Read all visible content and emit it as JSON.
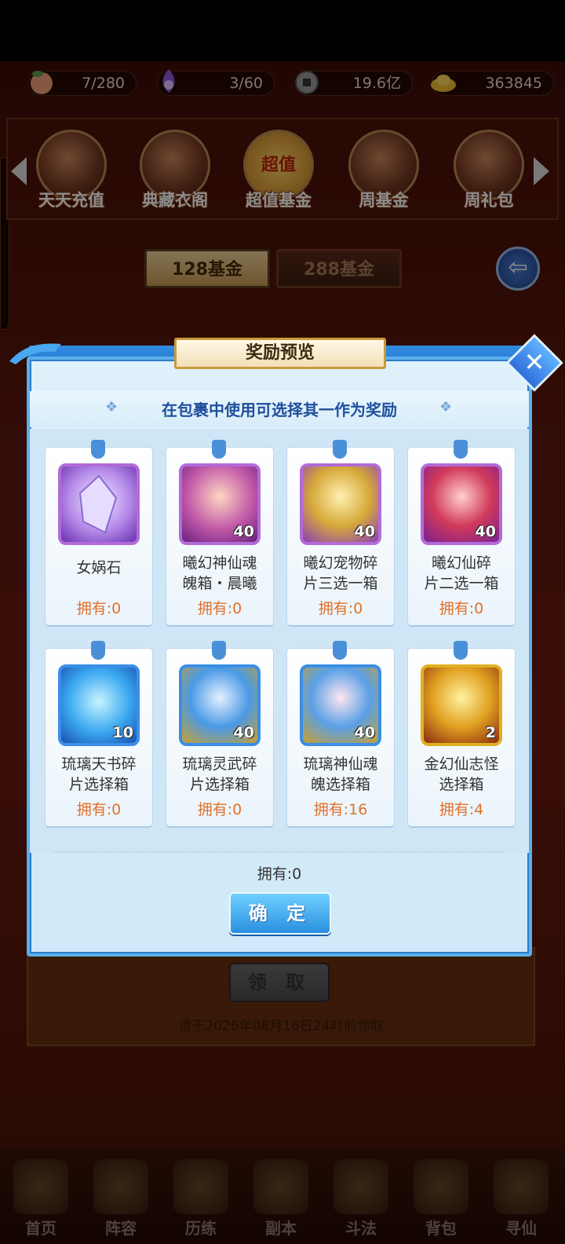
{
  "resources": [
    {
      "name": "peach-icon",
      "value": "7/280",
      "color": "#e88a6a"
    },
    {
      "name": "spirit-flame-icon",
      "value": "3/60",
      "color": "#8a5ae0"
    },
    {
      "name": "coin-icon",
      "value": "19.6亿",
      "color": "#777777"
    },
    {
      "name": "gold-ingot-icon",
      "value": "363845",
      "color": "#f0c030"
    }
  ],
  "tabs": [
    {
      "label": "天天充值",
      "icon": "red-envelope-icon"
    },
    {
      "label": "典藏衣阁",
      "icon": "treasure-chest-icon"
    },
    {
      "label": "超值基金",
      "icon": "super-value-icon",
      "badge": "超值"
    },
    {
      "label": "周基金",
      "icon": "gold-pile-icon"
    },
    {
      "label": "周礼包",
      "icon": "gift-box-icon"
    }
  ],
  "fund_tabs": {
    "active": "128基金",
    "inactive": "288基金"
  },
  "dialog": {
    "title": "奖励预览",
    "subtitle": "在包裹中使用可选择其一作为奖励",
    "items": [
      {
        "name": "女娲石",
        "own": "拥有:0",
        "qty": "",
        "icon": "crystal-icon",
        "frame": "#b26bd8"
      },
      {
        "name": "曦幻神仙魂魄箱·晨曦",
        "name_l1": "曦幻神仙魂",
        "name_l2": "魄箱・晨曦",
        "own": "拥有:0",
        "qty": "40",
        "icon": "immortal-soul-chest-icon",
        "frame": "#b26bd8"
      },
      {
        "name": "曦幻宠物碎片三选一箱",
        "name_l1": "曦幻宠物碎",
        "name_l2": "片三选一箱",
        "own": "拥有:0",
        "qty": "40",
        "icon": "pet-fragment-chest-icon",
        "frame": "#b26bd8"
      },
      {
        "name": "曦幻仙碎片二选一箱",
        "name_l1": "曦幻仙碎",
        "name_l2": "片二选一箱",
        "own": "拥有:0",
        "qty": "40",
        "icon": "immortal-fragment-chest-icon",
        "frame": "#b26bd8"
      },
      {
        "name": "琉璃天书碎片选择箱",
        "name_l1": "琉璃天书碎",
        "name_l2": "片选择箱",
        "own": "拥有:0",
        "qty": "10",
        "icon": "celestial-book-chest-icon",
        "frame": "#3a8ee6"
      },
      {
        "name": "琉璃灵武碎片选择箱",
        "name_l1": "琉璃灵武碎",
        "name_l2": "片选择箱",
        "own": "拥有:0",
        "qty": "40",
        "icon": "spirit-weapon-chest-icon",
        "frame": "#3a8ee6"
      },
      {
        "name": "琉璃神仙魂魄选择箱",
        "name_l1": "琉璃神仙魂",
        "name_l2": "魄选择箱",
        "own": "拥有:16",
        "qty": "40",
        "icon": "divine-soul-chest-icon",
        "frame": "#3a8ee6"
      },
      {
        "name": "金幻仙志怪选择箱",
        "name_l1": "金幻仙志怪",
        "name_l2": "选择箱",
        "own": "拥有:4",
        "qty": "2",
        "icon": "golden-treasure-chest-icon",
        "frame": "#e0b020"
      }
    ],
    "total_own": "拥有:0",
    "confirm_label": "确 定"
  },
  "claim": {
    "button": "领 取",
    "deadline": "请于2026年08月16日24时前领取"
  },
  "nav": [
    {
      "label": "首页",
      "icon": "home-icon"
    },
    {
      "label": "阵容",
      "icon": "lineup-icon"
    },
    {
      "label": "历练",
      "icon": "training-icon"
    },
    {
      "label": "副本",
      "icon": "dungeon-icon"
    },
    {
      "label": "斗法",
      "icon": "battle-icon"
    },
    {
      "label": "背包",
      "icon": "bag-icon"
    },
    {
      "label": "寻仙",
      "icon": "seek-immortal-icon"
    }
  ]
}
